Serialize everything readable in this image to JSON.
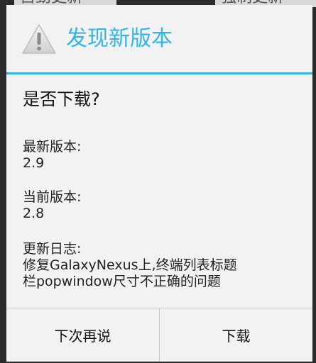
{
  "background": {
    "left_button_label": "自動更新",
    "right_button_label": "强制更新"
  },
  "dialog": {
    "icon": "warning-icon",
    "title": "发现新版本",
    "question": "是否下载?",
    "latest_version": {
      "label": "最新版本:",
      "value": "2.9"
    },
    "current_version": {
      "label": "当前版本:",
      "value": "2.8"
    },
    "update_log": {
      "label": "更新日志:",
      "line1": "修复GalaxyNexus上,终端列表标题",
      "line2": "栏popwindow尺寸不正确的问题"
    },
    "buttons": {
      "negative_label": "下次再说",
      "positive_label": "下载"
    }
  },
  "colors": {
    "accent": "#33b5e5",
    "dialog_background": "#f2f2f2",
    "backdrop": "#2b2b2b"
  }
}
